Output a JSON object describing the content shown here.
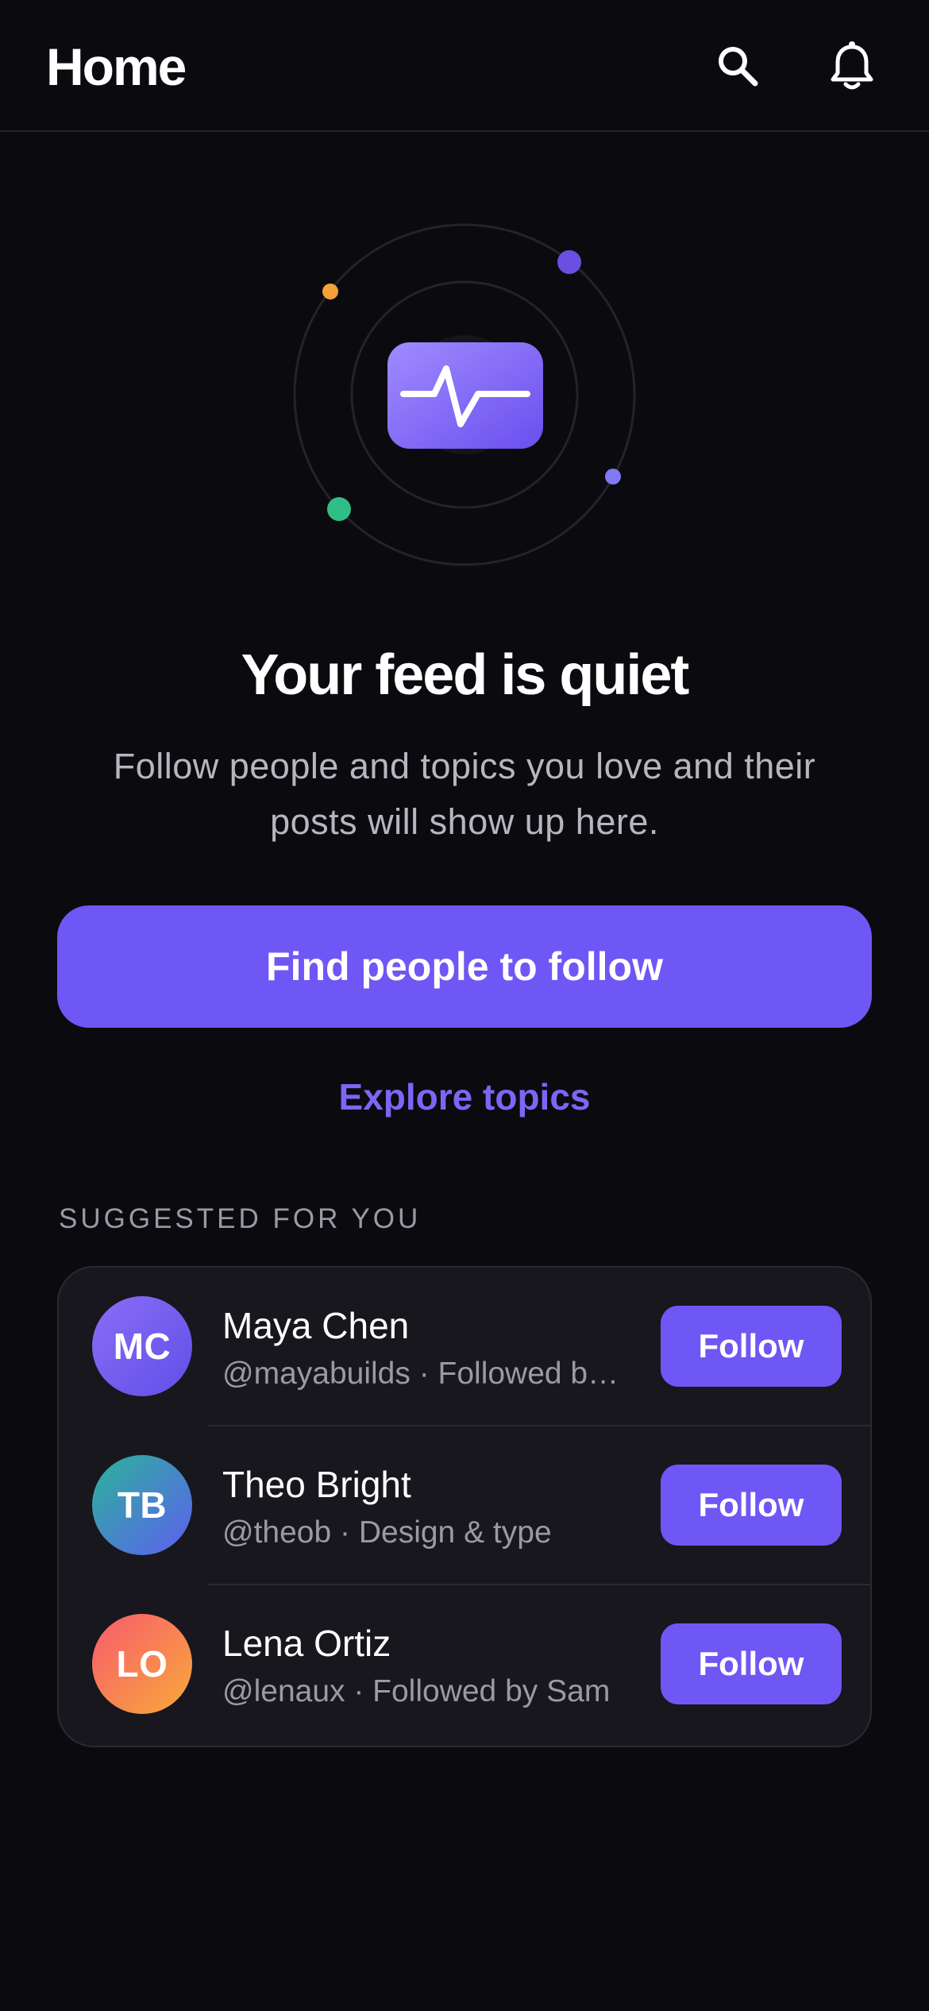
{
  "header": {
    "title": "Home",
    "icons": [
      "search-icon",
      "bell-icon"
    ]
  },
  "illustration": {
    "icon": "activity-pulse-icon",
    "accent_color": "#7b61ff",
    "dot_colors": [
      "#f5a13a",
      "#6a4fe0",
      "#2fbf86",
      "#7f7af3"
    ]
  },
  "empty_state": {
    "title": "Your feed is quiet",
    "subtitle_line1": "Follow people and topics you love and their",
    "subtitle_line2": "posts will show up here.",
    "primary_button": "Find people to follow",
    "secondary_link": "Explore topics"
  },
  "suggested": {
    "label": "SUGGESTED FOR YOU",
    "people": [
      {
        "initials": "MC",
        "name": "Maya Chen",
        "meta": "@mayabuilds · Followed by Sam",
        "button": "Follow"
      },
      {
        "initials": "TB",
        "name": "Theo Bright",
        "meta": "@theob · Design & type",
        "button": "Follow"
      },
      {
        "initials": "LO",
        "name": "Lena Ortiz",
        "meta": "@lenaux · Followed by Sam",
        "button": "Follow"
      }
    ]
  },
  "colors": {
    "background": "#0b0b0f",
    "accent": "#6f57f5",
    "card": "#17171d",
    "muted_text": "#9a9aa4"
  }
}
